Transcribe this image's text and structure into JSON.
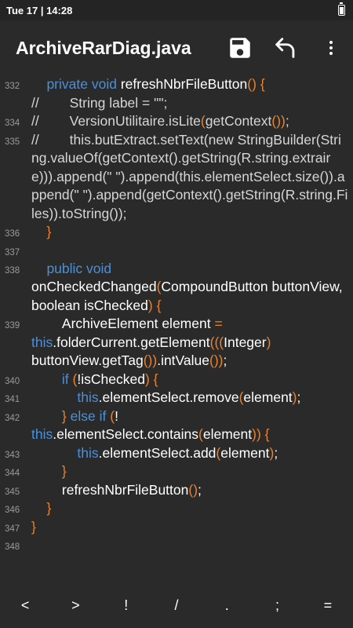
{
  "status": {
    "time": "Tue 17 | 14:28"
  },
  "appbar": {
    "title": "ArchiveRarDiag.java"
  },
  "lines": [
    {
      "num": "332",
      "parts": [
        [
          "    ",
          ""
        ],
        [
          "private void",
          "kw"
        ],
        [
          " refreshNbrFileButton",
          ""
        ],
        [
          "()",
          "br"
        ],
        [
          " ",
          ""
        ],
        [
          "{",
          "br"
        ]
      ]
    },
    {
      "num": "",
      "parts": [
        [
          "//        String label = \"\";",
          "cm"
        ]
      ]
    },
    {
      "num": "334",
      "parts": [
        [
          "//        VersionUtilitaire.isLite",
          "cm"
        ],
        [
          "(",
          "br"
        ],
        [
          "getContext",
          "cm"
        ],
        [
          "()",
          "br"
        ],
        [
          ")",
          "br"
        ],
        [
          ";",
          "cm"
        ]
      ]
    },
    {
      "num": "335",
      "parts": [
        [
          "//        this.butExtract.setText(new StringBuilder(String.valueOf(getContext().getString(R.string.extraire))).append(\" \").append(this.elementSelect.size()).append(\" \").append(getContext().getString(R.string.Files)).toString());",
          "cm"
        ]
      ]
    },
    {
      "num": "336",
      "parts": [
        [
          "    ",
          ""
        ],
        [
          "}",
          "br"
        ]
      ]
    },
    {
      "num": "337",
      "parts": [
        [
          "",
          ""
        ]
      ]
    },
    {
      "num": "338",
      "parts": [
        [
          "    ",
          ""
        ],
        [
          "public void",
          "kw"
        ],
        [
          "\nonCheckedChanged",
          ""
        ],
        [
          "(",
          "br"
        ],
        [
          "CompoundButton buttonView, boolean isChecked",
          ""
        ],
        [
          ")",
          "br"
        ],
        [
          " ",
          ""
        ],
        [
          "{",
          "br"
        ]
      ]
    },
    {
      "num": "339",
      "parts": [
        [
          "        ArchiveElement element ",
          ""
        ],
        [
          "=",
          "br"
        ],
        [
          "\n",
          ""
        ],
        [
          "this",
          "kw"
        ],
        [
          ".folderCurrent.getElement",
          ""
        ],
        [
          "(((",
          "br"
        ],
        [
          "Integer",
          ""
        ],
        [
          ")",
          "br"
        ],
        [
          "\nbuttonView.getTag",
          ""
        ],
        [
          "())",
          "br"
        ],
        [
          ".intValue",
          ""
        ],
        [
          "())",
          "br"
        ],
        [
          ";",
          ""
        ]
      ]
    },
    {
      "num": "340",
      "parts": [
        [
          "        ",
          ""
        ],
        [
          "if",
          "kw"
        ],
        [
          " ",
          ""
        ],
        [
          "(",
          "br"
        ],
        [
          "!isChecked",
          ""
        ],
        [
          ")",
          "br"
        ],
        [
          " ",
          ""
        ],
        [
          "{",
          "br"
        ]
      ]
    },
    {
      "num": "341",
      "parts": [
        [
          "            ",
          ""
        ],
        [
          "this",
          "kw"
        ],
        [
          ".elementSelect.remove",
          ""
        ],
        [
          "(",
          "br"
        ],
        [
          "element",
          ""
        ],
        [
          ")",
          "br"
        ],
        [
          ";",
          ""
        ]
      ]
    },
    {
      "num": "342",
      "parts": [
        [
          "        ",
          ""
        ],
        [
          "}",
          "br"
        ],
        [
          " ",
          ""
        ],
        [
          "else if",
          "kw"
        ],
        [
          " ",
          ""
        ],
        [
          "(",
          "br"
        ],
        [
          "!",
          ""
        ],
        [
          "\n",
          ""
        ],
        [
          "this",
          "kw"
        ],
        [
          ".elementSelect.contains",
          ""
        ],
        [
          "(",
          "br"
        ],
        [
          "element",
          ""
        ],
        [
          "))",
          "br"
        ],
        [
          " ",
          ""
        ],
        [
          "{",
          "br"
        ]
      ]
    },
    {
      "num": "343",
      "parts": [
        [
          "            ",
          ""
        ],
        [
          "this",
          "kw"
        ],
        [
          ".elementSelect.add",
          ""
        ],
        [
          "(",
          "br"
        ],
        [
          "element",
          ""
        ],
        [
          ")",
          "br"
        ],
        [
          ";",
          ""
        ]
      ]
    },
    {
      "num": "344",
      "parts": [
        [
          "        ",
          ""
        ],
        [
          "}",
          "br"
        ]
      ]
    },
    {
      "num": "345",
      "parts": [
        [
          "        refreshNbrFileButton",
          ""
        ],
        [
          "()",
          "br"
        ],
        [
          ";",
          ""
        ]
      ]
    },
    {
      "num": "346",
      "parts": [
        [
          "    ",
          ""
        ],
        [
          "}",
          "br"
        ]
      ]
    },
    {
      "num": "347",
      "parts": [
        [
          "}",
          "br"
        ]
      ]
    },
    {
      "num": "348",
      "parts": [
        [
          "",
          ""
        ]
      ]
    }
  ],
  "keys": [
    "<",
    ">",
    "!",
    "/",
    ".",
    ";",
    "="
  ]
}
